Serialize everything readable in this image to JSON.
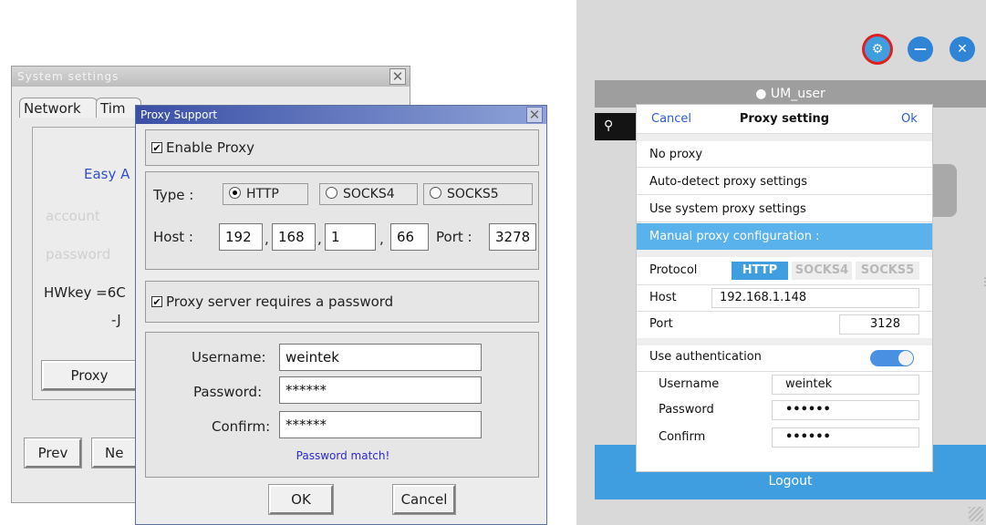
{
  "system_settings": {
    "title": "System settings",
    "tabs": [
      "Network",
      "Tim"
    ],
    "easy_access_label": "Easy A",
    "faded_field_1": "account",
    "faded_field_2": "password",
    "hwkey_label": "HWkey =6C",
    "hwkey_suffix": "-J",
    "proxy_button": "Proxy",
    "prev_button": "Prev",
    "next_button": "Ne"
  },
  "proxy_support": {
    "title": "Proxy Support",
    "enable_proxy_label": "Enable Proxy",
    "enable_proxy_checked": true,
    "type_label": "Type :",
    "type_options": [
      "HTTP",
      "SOCKS4",
      "SOCKS5"
    ],
    "type_selected": "HTTP",
    "host_label": "Host :",
    "host_octets": [
      "192",
      "168",
      "1",
      "66"
    ],
    "port_label": "Port :",
    "port_value": "3278",
    "requires_password_label": "Proxy server requires a password",
    "requires_password_checked": true,
    "username_label": "Username:",
    "username_value": "weintek",
    "password_label": "Password:",
    "password_value": "******",
    "confirm_label": "Confirm:",
    "confirm_value": "******",
    "match_message": "Password match!",
    "ok_button": "OK",
    "cancel_button": "Cancel"
  },
  "app": {
    "user_name": "UM_user",
    "logout_label": "Logout",
    "colors": {
      "accent": "#3e9ee0",
      "highlight": "#5ab2ec",
      "toggle": "#4a90e2",
      "gear_ring": "#e02020"
    },
    "icons": [
      "gear-icon",
      "minimize-icon",
      "close-icon",
      "user-icon",
      "search-icon"
    ]
  },
  "proxy_setting": {
    "cancel_label": "Cancel",
    "title": "Proxy setting",
    "ok_label": "Ok",
    "options": [
      "No proxy",
      "Auto-detect proxy settings",
      "Use system proxy settings",
      "Manual proxy configuration :"
    ],
    "selected_option": "Manual proxy configuration :",
    "protocol_label": "Protocol",
    "protocols": [
      "HTTP",
      "SOCKS4",
      "SOCKS5"
    ],
    "protocol_selected": "HTTP",
    "host_label": "Host",
    "host_value": "192.168.1.148",
    "port_label": "Port",
    "port_value": "3128",
    "use_auth_label": "Use authentication",
    "use_auth_on": true,
    "username_label": "Username",
    "username_value": "weintek",
    "password_label": "Password",
    "password_value": "••••••",
    "confirm_label": "Confirm",
    "confirm_value": "••••••"
  }
}
